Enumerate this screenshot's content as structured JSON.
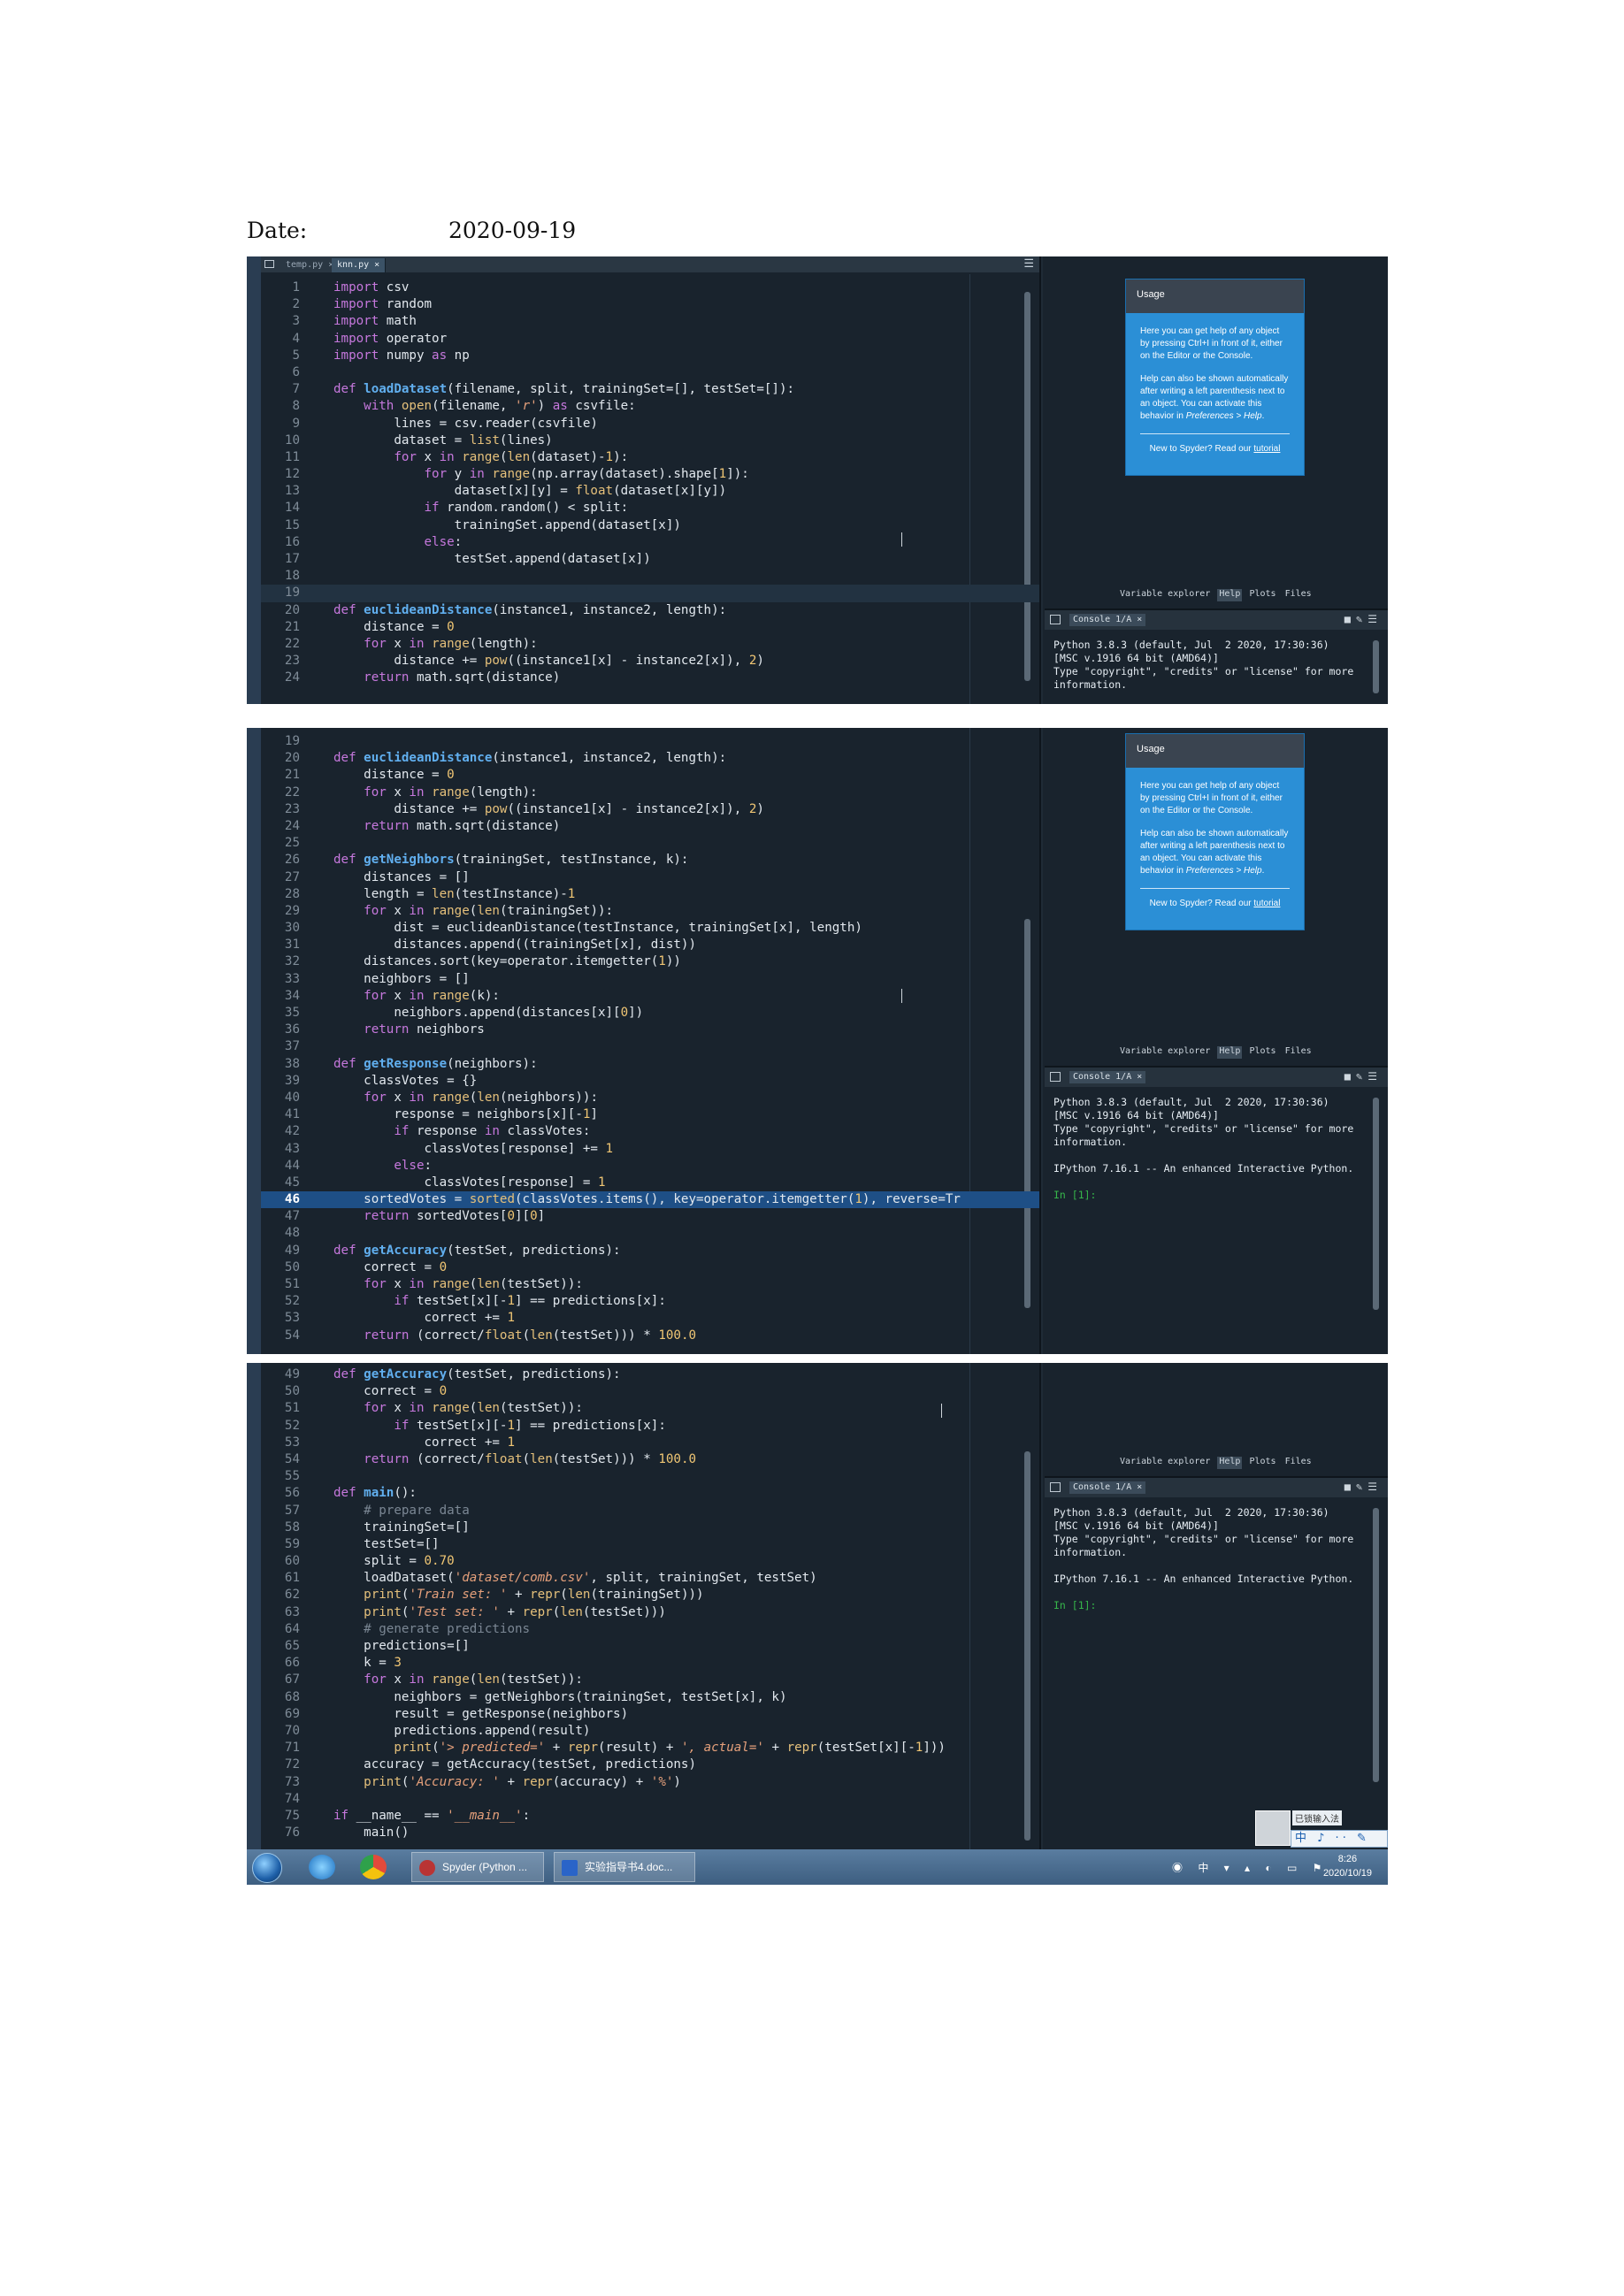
{
  "date": {
    "label": "Date:",
    "value": "2020-09-19"
  },
  "editor_tabs": [
    {
      "label": "temp.py",
      "close": "×",
      "active": false
    },
    {
      "label": "knn.py",
      "close": "×",
      "active": true
    }
  ],
  "tab_menu_icon": "hamburger-menu-icon",
  "usage": {
    "title": "Usage",
    "p1": "Here you can get help of any object by pressing Ctrl+I in front of it, either on the Editor or the Console.",
    "p2_a": "Help can also be shown automatically after writing a left parenthesis next to an object. You can activate this behavior in ",
    "p2_link": "Preferences > Help",
    "p2_b": ".",
    "footer_a": "New to Spyder? Read our ",
    "footer_link": "tutorial"
  },
  "pane_tabs": [
    "Variable explorer",
    "Help",
    "Plots",
    "Files"
  ],
  "console": {
    "tab": "Console 1/A",
    "close": "×",
    "python_line1": "Python 3.8.3 (default, Jul  2 2020, 17:30:36)",
    "python_line2": "[MSC v.1916 64 bit (AMD64)]",
    "python_line3": "Type \"copyright\", \"credits\" or \"license\" for more",
    "python_line4": "information.",
    "ipython_line": "IPython 7.16.1 -- An enhanced Interactive Python.",
    "prompt": "In [1]:"
  },
  "taskbar": {
    "apps": [
      {
        "label": "Spyder (Python ..."
      },
      {
        "label": "实验指导书4.doc..."
      }
    ],
    "time": "8:26",
    "date": "2020/10/19"
  },
  "ime": {
    "label": "已锁输入法",
    "bar": "中 ♪ ·· ✎ ▤"
  },
  "code_lines": {
    "1": "import csv",
    "2": "import random",
    "3": "import math",
    "4": "import operator",
    "5": "import numpy as np",
    "6": "",
    "7": "def loadDataset(filename, split, trainingSet=[], testSet=[]):",
    "8": "    with open(filename, 'r') as csvfile:",
    "9": "        lines = csv.reader(csvfile)",
    "10": "        dataset = list(lines)",
    "11": "        for x in range(len(dataset)-1):",
    "12": "            for y in range(np.array(dataset).shape[1]):",
    "13": "                dataset[x][y] = float(dataset[x][y])",
    "14": "            if random.random() < split:",
    "15": "                trainingSet.append(dataset[x])",
    "16": "            else:",
    "17": "                testSet.append(dataset[x])",
    "18": "",
    "19": "",
    "20": "def euclideanDistance(instance1, instance2, length):",
    "21": "    distance = 0",
    "22": "    for x in range(length):",
    "23": "        distance += pow((instance1[x] - instance2[x]), 2)",
    "24": "    return math.sqrt(distance)",
    "25": "",
    "26": "def getNeighbors(trainingSet, testInstance, k):",
    "27": "    distances = []",
    "28": "    length = len(testInstance)-1",
    "29": "    for x in range(len(trainingSet)):",
    "30": "        dist = euclideanDistance(testInstance, trainingSet[x], length)",
    "31": "        distances.append((trainingSet[x], dist))",
    "32": "    distances.sort(key=operator.itemgetter(1))",
    "33": "    neighbors = []",
    "34": "    for x in range(k):",
    "35": "        neighbors.append(distances[x][0])",
    "36": "    return neighbors",
    "37": "",
    "38": "def getResponse(neighbors):",
    "39": "    classVotes = {}",
    "40": "    for x in range(len(neighbors)):",
    "41": "        response = neighbors[x][-1]",
    "42": "        if response in classVotes:",
    "43": "            classVotes[response] += 1",
    "44": "        else:",
    "45": "            classVotes[response] = 1",
    "46": "    sortedVotes = sorted(classVotes.items(), key=operator.itemgetter(1), reverse=Tr",
    "47": "    return sortedVotes[0][0]",
    "48": "",
    "49": "def getAccuracy(testSet, predictions):",
    "50": "    correct = 0",
    "51": "    for x in range(len(testSet)):",
    "52": "        if testSet[x][-1] == predictions[x]:",
    "53": "            correct += 1",
    "54": "    return (correct/float(len(testSet))) * 100.0",
    "55": "",
    "56": "def main():",
    "57": "    # prepare data",
    "58": "    trainingSet=[]",
    "59": "    testSet=[]",
    "60": "    split = 0.70",
    "61": "    loadDataset('dataset/comb.csv', split, trainingSet, testSet)",
    "62": "    print('Train set: ' + repr(len(trainingSet)))",
    "63": "    print('Test set: ' + repr(len(testSet)))",
    "64": "    # generate predictions",
    "65": "    predictions=[]",
    "66": "    k = 3",
    "67": "    for x in range(len(testSet)):",
    "68": "        neighbors = getNeighbors(trainingSet, testSet[x], k)",
    "69": "        result = getResponse(neighbors)",
    "70": "        predictions.append(result)",
    "71": "        print('> predicted=' + repr(result) + ', actual=' + repr(testSet[x][-1]))",
    "72": "    accuracy = getAccuracy(testSet, predictions)",
    "73": "    print('Accuracy: ' + repr(accuracy) + '%')",
    "74": "",
    "75": "if __name__ == '__main__':",
    "76": "    main()"
  }
}
